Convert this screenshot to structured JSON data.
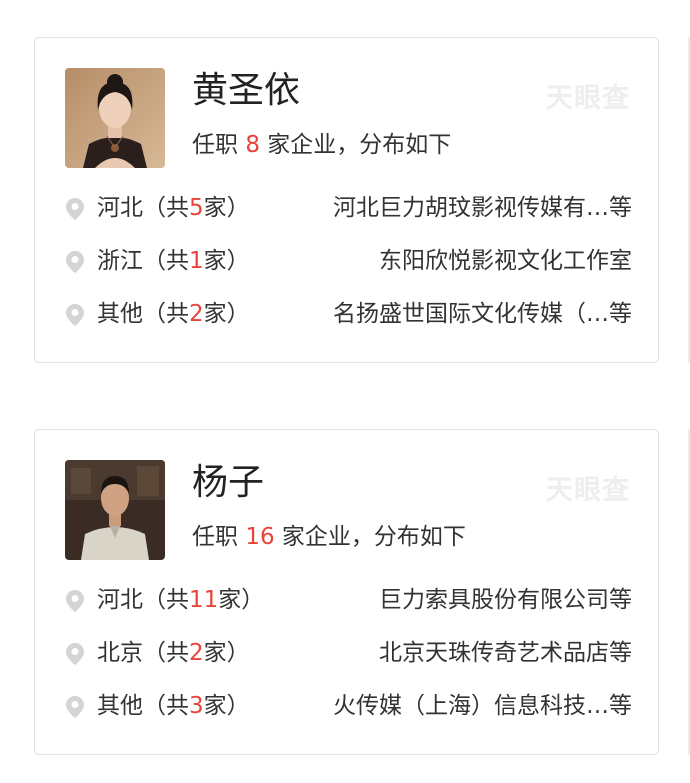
{
  "cards": [
    {
      "name": "黄圣依",
      "summary_prefix": "任职 ",
      "company_count": "8",
      "summary_suffix": " 家企业，分布如下",
      "watermark": "天眼查",
      "regions": [
        {
          "region": "河北",
          "open": "（共",
          "count": "5",
          "close": "家）",
          "companies": "河北巨力胡玟影视传媒有…等"
        },
        {
          "region": "浙江",
          "open": "（共",
          "count": "1",
          "close": "家）",
          "companies": "东阳欣悦影视文化工作室"
        },
        {
          "region": "其他",
          "open": "（共",
          "count": "2",
          "close": "家）",
          "companies": "名扬盛世国际文化传媒（…等"
        }
      ]
    },
    {
      "name": "杨子",
      "summary_prefix": "任职 ",
      "company_count": "16",
      "summary_suffix": " 家企业，分布如下",
      "watermark": "天眼查",
      "regions": [
        {
          "region": "河北",
          "open": "（共",
          "count": "11",
          "close": "家）",
          "companies": "巨力索具股份有限公司等"
        },
        {
          "region": "北京",
          "open": "（共",
          "count": "2",
          "close": "家）",
          "companies": "北京天珠传奇艺术品店等"
        },
        {
          "region": "其他",
          "open": "（共",
          "count": "3",
          "close": "家）",
          "companies": "火传媒（上海）信息科技…等"
        }
      ]
    }
  ],
  "colors": {
    "accent_red": "#e8433a",
    "border": "#e2e2e2",
    "text": "#333333",
    "pin": "#d4d4d4",
    "watermark": "#eeeeee"
  },
  "icons": {
    "location": "map-pin-icon"
  }
}
